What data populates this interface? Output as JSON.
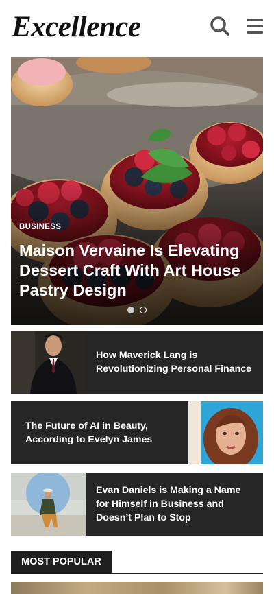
{
  "site": {
    "logo": "Excellence"
  },
  "header": {
    "search_icon": "search-icon",
    "menu_icon": "hamburger-menu-icon"
  },
  "hero": {
    "category": "BUSINESS",
    "title": "Maison Vervaine Is Elevating Dessert Craft With Art House Pastry Design",
    "slides_total": 2,
    "active_slide": 1
  },
  "articles": [
    {
      "title": "How Maverick Lang is Revolutionizing Personal Finance",
      "image": "man-in-suit-portrait"
    },
    {
      "title": "The Future of AI in Beauty, According to Evelyn James",
      "image": "woman-portrait"
    },
    {
      "title": "Evan Daniels is Making a Name for Himself in Business and Doesn’t Plan to Stop",
      "image": "man-seated-outdoors"
    }
  ],
  "sections": {
    "most_popular": "MOST POPULAR"
  },
  "colors": {
    "card_bg": "#262626",
    "text_dark": "#111111",
    "text_light": "#ffffff"
  }
}
